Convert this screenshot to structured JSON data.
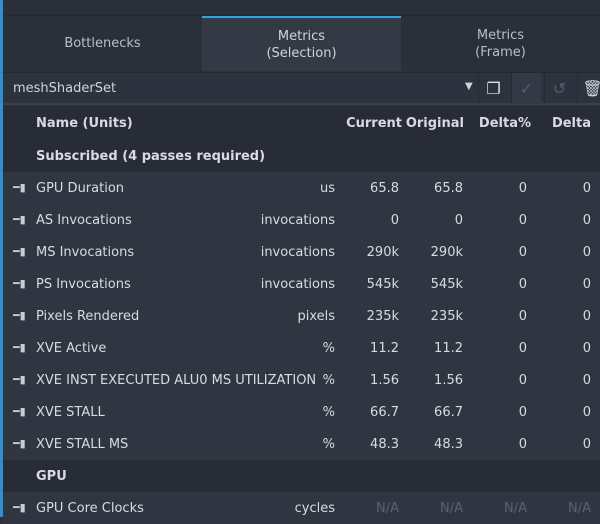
{
  "tabs": [
    "Bottlenecks",
    "Metrics\n(Selection)",
    "Metrics\n(Frame)"
  ],
  "active_tab": 1,
  "toolbar": {
    "selected_set": "meshShaderSet",
    "icons": [
      "copy-icon",
      "check-icon",
      "undo-icon",
      "trash-icon"
    ]
  },
  "columns": {
    "name": "Name (Units)",
    "current": "Current",
    "original": "Original",
    "delta_pct": "Delta%",
    "delta": "Delta"
  },
  "sections": [
    {
      "title": "Subscribed (4 passes required)",
      "rows": [
        {
          "name": "GPU Duration",
          "unit": "us",
          "current": "65.8",
          "original": "65.8",
          "delta_pct": "0",
          "delta": "0"
        },
        {
          "name": "AS Invocations",
          "unit": "invocations",
          "current": "0",
          "original": "0",
          "delta_pct": "0",
          "delta": "0"
        },
        {
          "name": "MS Invocations",
          "unit": "invocations",
          "current": "290k",
          "original": "290k",
          "delta_pct": "0",
          "delta": "0"
        },
        {
          "name": "PS Invocations",
          "unit": "invocations",
          "current": "545k",
          "original": "545k",
          "delta_pct": "0",
          "delta": "0"
        },
        {
          "name": "Pixels Rendered",
          "unit": "pixels",
          "current": "235k",
          "original": "235k",
          "delta_pct": "0",
          "delta": "0"
        },
        {
          "name": "XVE Active",
          "unit": "%",
          "current": "11.2",
          "original": "11.2",
          "delta_pct": "0",
          "delta": "0"
        },
        {
          "name": "XVE INST EXECUTED ALU0 MS UTILIZATION",
          "unit": "%",
          "current": "1.56",
          "original": "1.56",
          "delta_pct": "0",
          "delta": "0"
        },
        {
          "name": "XVE STALL",
          "unit": "%",
          "current": "66.7",
          "original": "66.7",
          "delta_pct": "0",
          "delta": "0"
        },
        {
          "name": "XVE STALL MS",
          "unit": "%",
          "current": "48.3",
          "original": "48.3",
          "delta_pct": "0",
          "delta": "0"
        }
      ]
    },
    {
      "title": "GPU",
      "rows": [
        {
          "name": "GPU Core Clocks",
          "unit": "cycles",
          "current": "N/A",
          "original": "N/A",
          "delta_pct": "N/A",
          "delta": "N/A"
        }
      ]
    }
  ]
}
